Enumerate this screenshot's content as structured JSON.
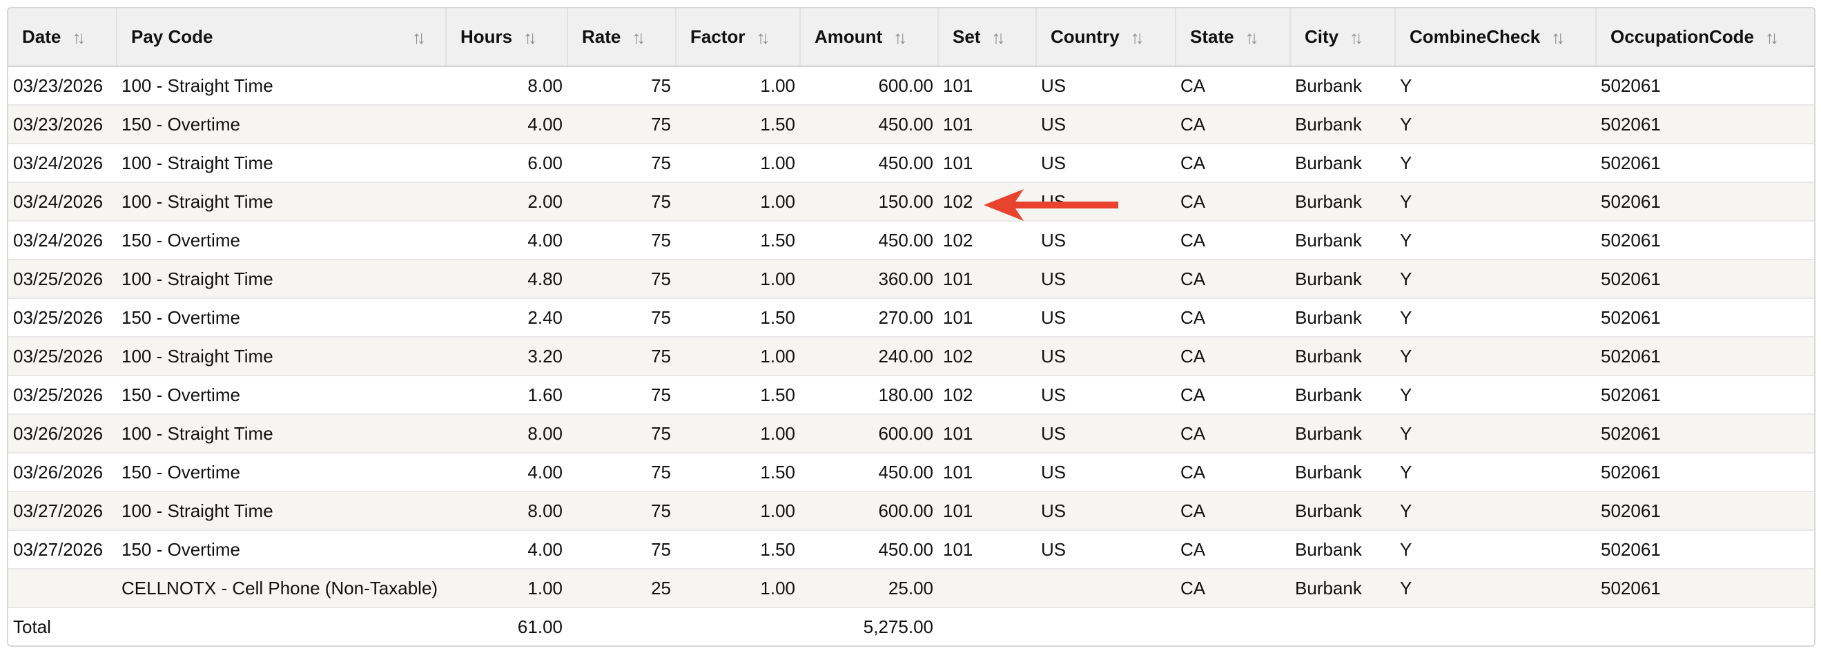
{
  "columns": [
    {
      "key": "date",
      "label": "Date"
    },
    {
      "key": "pay_code",
      "label": "Pay Code"
    },
    {
      "key": "hours",
      "label": "Hours"
    },
    {
      "key": "rate",
      "label": "Rate"
    },
    {
      "key": "factor",
      "label": "Factor"
    },
    {
      "key": "amount",
      "label": "Amount"
    },
    {
      "key": "set",
      "label": "Set"
    },
    {
      "key": "country",
      "label": "Country"
    },
    {
      "key": "state",
      "label": "State"
    },
    {
      "key": "city",
      "label": "City"
    },
    {
      "key": "combine_check",
      "label": "CombineCheck"
    },
    {
      "key": "occupation_code",
      "label": "OccupationCode"
    }
  ],
  "rows": [
    {
      "date": "03/23/2026",
      "pay_code": "100 - Straight Time",
      "hours": "8.00",
      "rate": "75",
      "factor": "1.00",
      "amount": "600.00",
      "set": "101",
      "country": "US",
      "state": "CA",
      "city": "Burbank",
      "combine_check": "Y",
      "occupation_code": "502061"
    },
    {
      "date": "03/23/2026",
      "pay_code": "150 - Overtime",
      "hours": "4.00",
      "rate": "75",
      "factor": "1.50",
      "amount": "450.00",
      "set": "101",
      "country": "US",
      "state": "CA",
      "city": "Burbank",
      "combine_check": "Y",
      "occupation_code": "502061"
    },
    {
      "date": "03/24/2026",
      "pay_code": "100 - Straight Time",
      "hours": "6.00",
      "rate": "75",
      "factor": "1.00",
      "amount": "450.00",
      "set": "101",
      "country": "US",
      "state": "CA",
      "city": "Burbank",
      "combine_check": "Y",
      "occupation_code": "502061"
    },
    {
      "date": "03/24/2026",
      "pay_code": "100 - Straight Time",
      "hours": "2.00",
      "rate": "75",
      "factor": "1.00",
      "amount": "150.00",
      "set": "102",
      "country": "US",
      "state": "CA",
      "city": "Burbank",
      "combine_check": "Y",
      "occupation_code": "502061"
    },
    {
      "date": "03/24/2026",
      "pay_code": "150 - Overtime",
      "hours": "4.00",
      "rate": "75",
      "factor": "1.50",
      "amount": "450.00",
      "set": "102",
      "country": "US",
      "state": "CA",
      "city": "Burbank",
      "combine_check": "Y",
      "occupation_code": "502061"
    },
    {
      "date": "03/25/2026",
      "pay_code": "100 - Straight Time",
      "hours": "4.80",
      "rate": "75",
      "factor": "1.00",
      "amount": "360.00",
      "set": "101",
      "country": "US",
      "state": "CA",
      "city": "Burbank",
      "combine_check": "Y",
      "occupation_code": "502061"
    },
    {
      "date": "03/25/2026",
      "pay_code": "150 - Overtime",
      "hours": "2.40",
      "rate": "75",
      "factor": "1.50",
      "amount": "270.00",
      "set": "101",
      "country": "US",
      "state": "CA",
      "city": "Burbank",
      "combine_check": "Y",
      "occupation_code": "502061"
    },
    {
      "date": "03/25/2026",
      "pay_code": "100 - Straight Time",
      "hours": "3.20",
      "rate": "75",
      "factor": "1.00",
      "amount": "240.00",
      "set": "102",
      "country": "US",
      "state": "CA",
      "city": "Burbank",
      "combine_check": "Y",
      "occupation_code": "502061"
    },
    {
      "date": "03/25/2026",
      "pay_code": "150 - Overtime",
      "hours": "1.60",
      "rate": "75",
      "factor": "1.50",
      "amount": "180.00",
      "set": "102",
      "country": "US",
      "state": "CA",
      "city": "Burbank",
      "combine_check": "Y",
      "occupation_code": "502061"
    },
    {
      "date": "03/26/2026",
      "pay_code": "100 - Straight Time",
      "hours": "8.00",
      "rate": "75",
      "factor": "1.00",
      "amount": "600.00",
      "set": "101",
      "country": "US",
      "state": "CA",
      "city": "Burbank",
      "combine_check": "Y",
      "occupation_code": "502061"
    },
    {
      "date": "03/26/2026",
      "pay_code": "150 - Overtime",
      "hours": "4.00",
      "rate": "75",
      "factor": "1.50",
      "amount": "450.00",
      "set": "101",
      "country": "US",
      "state": "CA",
      "city": "Burbank",
      "combine_check": "Y",
      "occupation_code": "502061"
    },
    {
      "date": "03/27/2026",
      "pay_code": "100 - Straight Time",
      "hours": "8.00",
      "rate": "75",
      "factor": "1.00",
      "amount": "600.00",
      "set": "101",
      "country": "US",
      "state": "CA",
      "city": "Burbank",
      "combine_check": "Y",
      "occupation_code": "502061"
    },
    {
      "date": "03/27/2026",
      "pay_code": "150 - Overtime",
      "hours": "4.00",
      "rate": "75",
      "factor": "1.50",
      "amount": "450.00",
      "set": "101",
      "country": "US",
      "state": "CA",
      "city": "Burbank",
      "combine_check": "Y",
      "occupation_code": "502061"
    },
    {
      "date": "",
      "pay_code": "CELLNOTX - Cell Phone (Non-Taxable)",
      "hours": "1.00",
      "rate": "25",
      "factor": "1.00",
      "amount": "25.00",
      "set": "",
      "country": "",
      "state": "CA",
      "city": "Burbank",
      "combine_check": "Y",
      "occupation_code": "502061"
    }
  ],
  "total": {
    "label": "Total",
    "hours": "61.00",
    "amount": "5,275.00"
  },
  "sort_icon": "sort-arrows-icon",
  "annotation": {
    "icon": "red-arrow-icon",
    "color": "#e8432d"
  },
  "colors": {
    "header_bg": "#f0f0f0",
    "stripe_bg": "#f7f5f1",
    "border": "#d7d7d7"
  }
}
